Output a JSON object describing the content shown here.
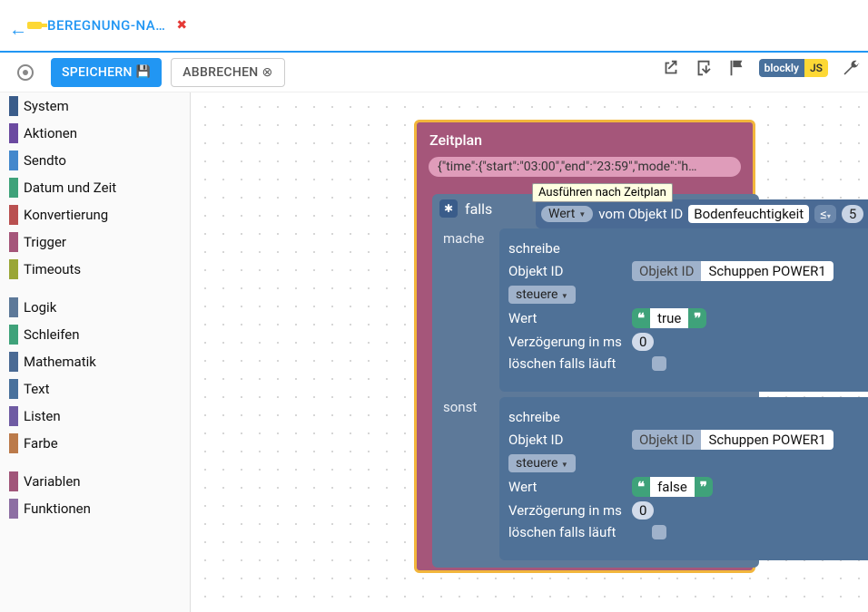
{
  "tab": {
    "title": "BEREGNUNG-NA…"
  },
  "toolbar": {
    "save": "SPEICHERN",
    "cancel": "ABBRECHEN",
    "toggle_blockly": "blockly",
    "toggle_js": "JS"
  },
  "sidebar": {
    "cats": [
      {
        "label": "System",
        "color": "#3a5c8a"
      },
      {
        "label": "Aktionen",
        "color": "#6b4aa0"
      },
      {
        "label": "Sendto",
        "color": "#4488cc"
      },
      {
        "label": "Datum und Zeit",
        "color": "#3fa27a"
      },
      {
        "label": "Konvertierung",
        "color": "#b95050"
      },
      {
        "label": "Trigger",
        "color": "#a5567a"
      },
      {
        "label": "Timeouts",
        "color": "#9aa637"
      }
    ],
    "cats2": [
      {
        "label": "Logik",
        "color": "#5d7999"
      },
      {
        "label": "Schleifen",
        "color": "#3fa27a"
      },
      {
        "label": "Mathematik",
        "color": "#4a6a94"
      },
      {
        "label": "Text",
        "color": "#49719c"
      },
      {
        "label": "Listen",
        "color": "#6f5ba3"
      },
      {
        "label": "Farbe",
        "color": "#bb7a4a"
      }
    ],
    "cats3": [
      {
        "label": "Variablen",
        "color": "#a1567a"
      },
      {
        "label": "Funktionen",
        "color": "#8d6fa3"
      }
    ]
  },
  "blocks": {
    "zeitplan_title": "Zeitplan",
    "zeitplan_json": "{\"time\":{\"start\":\"03:00\",\"end\":\"23:59\",\"mode\":\"h…",
    "tooltip": "Ausführen nach Zeitplan",
    "falls": "falls",
    "mache": "mache",
    "sonst": "sonst",
    "wert_drop": "Wert",
    "vom_oid": "vom Objekt ID",
    "bodenfeuchtigkeit": "Bodenfeuchtigkeit",
    "op": "≤",
    "threshold": "5",
    "write": {
      "schreibe": "schreibe",
      "oid_lbl": "Objekt ID",
      "oid_tag": "Objekt ID",
      "oid_val": "Schuppen POWER1",
      "steuere": "steuere",
      "wert": "Wert",
      "val_true": "true",
      "val_false": "false",
      "delay_lbl": "Verzögerung in ms",
      "delay_val": "0",
      "clear_lbl": "löschen falls läuft"
    }
  }
}
